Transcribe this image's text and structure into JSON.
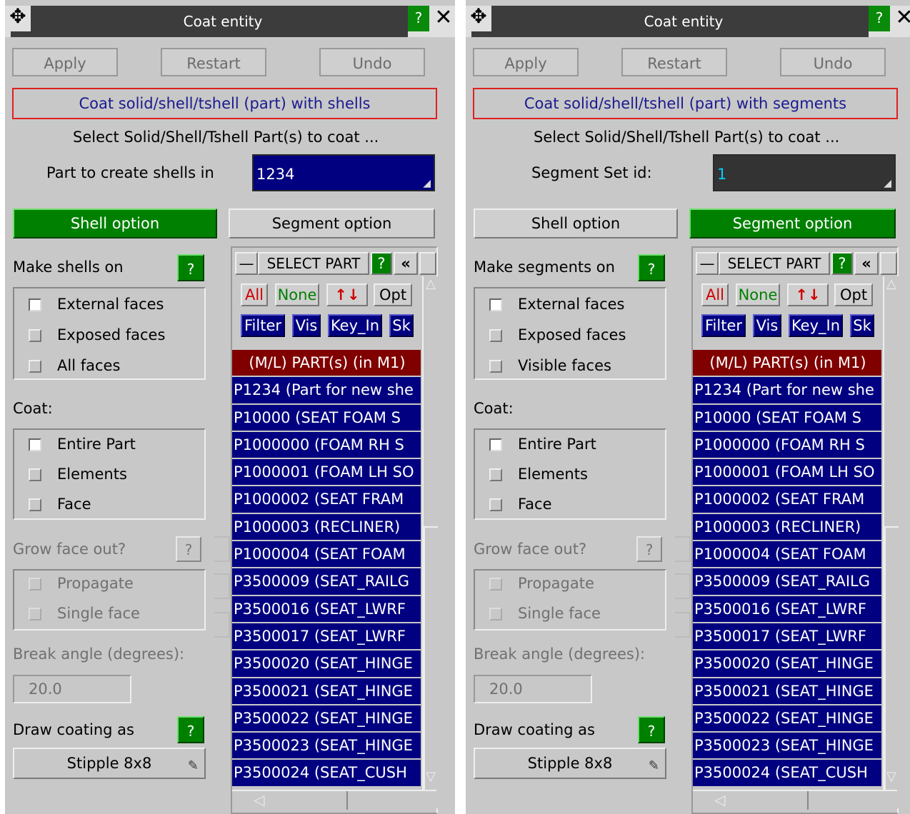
{
  "colors": {
    "panel": "#c8c8c8",
    "title_bar": "#3c3c3c",
    "help_green": "#008000",
    "list_row": "#000080",
    "list_header": "#800000",
    "mode_border": "#e02020",
    "mode_text": "#1a1a90"
  },
  "panels": [
    {
      "title": "Coat entity",
      "help": "?",
      "close": "✕",
      "move_icon": "✥",
      "apply": "Apply",
      "restart": "Restart",
      "undo": "Undo",
      "mode": "Coat solid/shell/tshell (part) with shells",
      "prompt": "Select Solid/Shell/Tshell Part(s) to coat ...",
      "field_label": "Part to create shells in",
      "field_value": "1234",
      "shell_option": "Shell option",
      "segment_option": "Segment option",
      "make_label": "Make shells on",
      "make_options": [
        "External faces",
        "Exposed faces",
        "All faces"
      ],
      "coat_label": "Coat:",
      "coat_options": [
        "Entire Part",
        "Elements",
        "Face"
      ],
      "grow_label": "Grow face out?",
      "grow_options": [
        "Propagate",
        "Single face"
      ],
      "break_label": "Break angle (degrees):",
      "break_value": "20.0",
      "draw_label": "Draw coating as",
      "draw_value": "Stipple 8x8",
      "select_title": "SELECT PART",
      "sel_all": "All",
      "sel_none": "None",
      "sel_flip": "↑↓",
      "sel_opt": "Opt",
      "sel_filter": "Filter",
      "sel_vis": "Vis",
      "sel_key": "Key_In",
      "sel_sk": "Sk",
      "list_header": "(M/L) PART(s) (in M1)",
      "list_items": [
        "P1234 (Part for new she",
        "P10000 (SEAT FOAM S",
        "P1000000 (FOAM RH S",
        "P1000001 (FOAM LH SO",
        "P1000002 (SEAT FRAM",
        "P1000003 (RECLINER)",
        "P1000004 (SEAT FOAM",
        "P3500009 (SEAT_RAILG",
        "P3500016 (SEAT_LWRF",
        "P3500017 (SEAT_LWRF",
        "P3500020 (SEAT_HINGE",
        "P3500021 (SEAT_HINGE",
        "P3500022 (SEAT_HINGE",
        "P3500023 (SEAT_HINGE",
        "P3500024 (SEAT_CUSH"
      ]
    },
    {
      "title": "Coat entity",
      "help": "?",
      "close": "✕",
      "move_icon": "✥",
      "apply": "Apply",
      "restart": "Restart",
      "undo": "Undo",
      "mode": "Coat solid/shell/tshell (part) with segments",
      "prompt": "Select Solid/Shell/Tshell Part(s) to coat ...",
      "field_label": "Segment Set id:",
      "field_value": "1",
      "shell_option": "Shell option",
      "segment_option": "Segment option",
      "make_label": "Make segments on",
      "make_options": [
        "External faces",
        "Exposed faces",
        "Visible faces"
      ],
      "coat_label": "Coat:",
      "coat_options": [
        "Entire Part",
        "Elements",
        "Face"
      ],
      "grow_label": "Grow face out?",
      "grow_options": [
        "Propagate",
        "Single face"
      ],
      "break_label": "Break angle (degrees):",
      "break_value": "20.0",
      "draw_label": "Draw coating as",
      "draw_value": "Stipple 8x8",
      "select_title": "SELECT PART",
      "sel_all": "All",
      "sel_none": "None",
      "sel_flip": "↑↓",
      "sel_opt": "Opt",
      "sel_filter": "Filter",
      "sel_vis": "Vis",
      "sel_key": "Key_In",
      "sel_sk": "Sk",
      "list_header": "(M/L) PART(s) (in M1)",
      "list_items": [
        "P1234 (Part for new she",
        "P10000 (SEAT FOAM S",
        "P1000000 (FOAM RH S",
        "P1000001 (FOAM LH SO",
        "P1000002 (SEAT FRAM",
        "P1000003 (RECLINER)",
        "P1000004 (SEAT FOAM",
        "P3500009 (SEAT_RAILG",
        "P3500016 (SEAT_LWRF",
        "P3500017 (SEAT_LWRF",
        "P3500020 (SEAT_HINGE",
        "P3500021 (SEAT_HINGE",
        "P3500022 (SEAT_HINGE",
        "P3500023 (SEAT_HINGE",
        "P3500024 (SEAT_CUSH"
      ]
    }
  ]
}
